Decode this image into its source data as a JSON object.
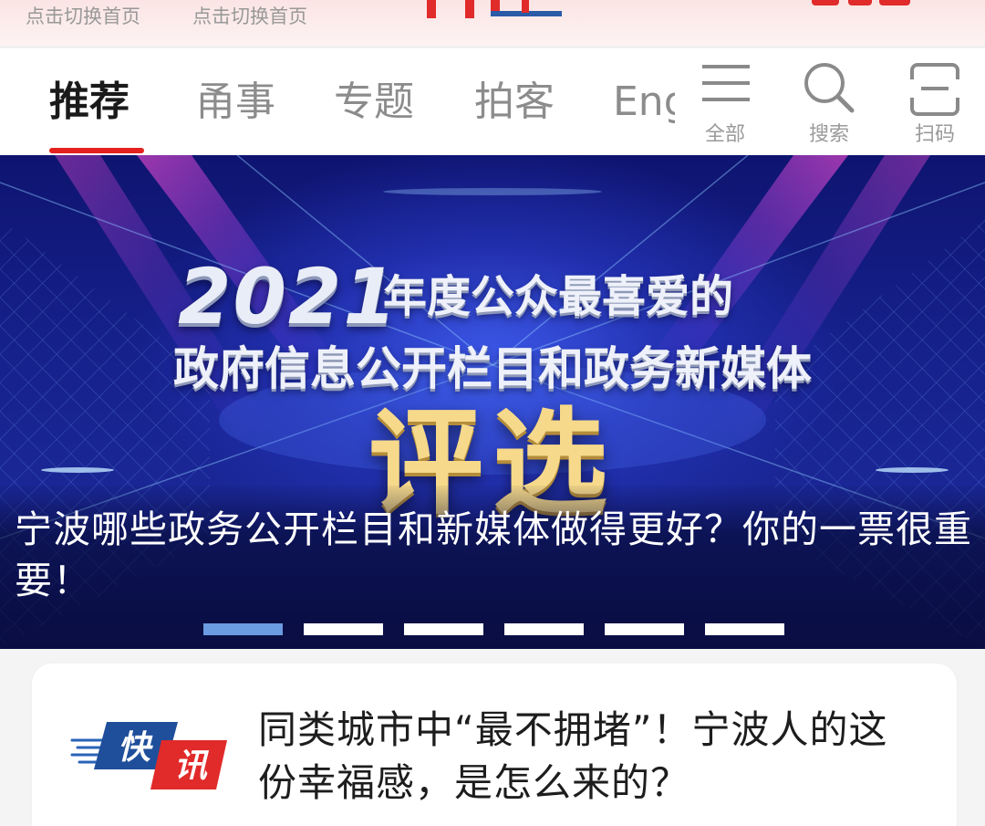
{
  "top_strip": {
    "switch_home_left": "点击切换首页",
    "switch_home_right": "点击切换首页"
  },
  "tabs": [
    {
      "label": "推荐",
      "active": true
    },
    {
      "label": "甬事",
      "active": false
    },
    {
      "label": "专题",
      "active": false
    },
    {
      "label": "拍客",
      "active": false
    },
    {
      "label": "English",
      "active": false
    }
  ],
  "tools": {
    "all": {
      "label": "全部",
      "icon": "menu-icon"
    },
    "search": {
      "label": "搜索",
      "icon": "search-icon"
    },
    "scan": {
      "label": "扫码",
      "icon": "scan-icon"
    }
  },
  "banner": {
    "poster_year": "2021",
    "poster_line1": "年度公众最喜爱的",
    "poster_line2": "政府信息公开栏目和政务新媒体",
    "poster_big": "评选",
    "caption": "宁波哪些政务公开栏目和新媒体做得更好？你的一票很重要！",
    "slide_count": 6,
    "active_slide": 1
  },
  "news": [
    {
      "badge": "快讯",
      "title": "同类城市中“最不拥堵”！宁波人的这份幸福感，是怎么来的？"
    }
  ],
  "colors": {
    "accent": "#e3211f",
    "dot_active": "#6b9be0",
    "tab_inactive": "#8c8c8c"
  }
}
